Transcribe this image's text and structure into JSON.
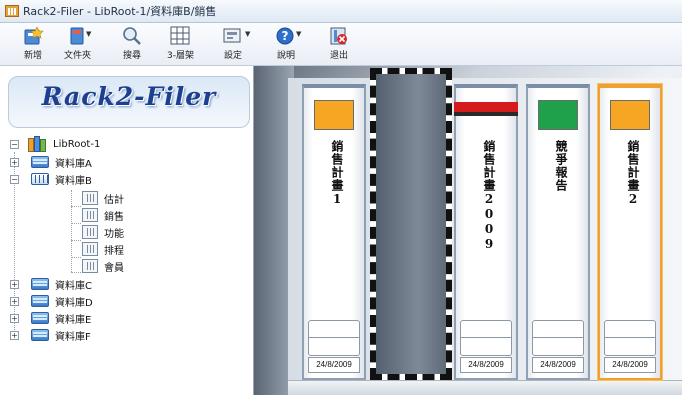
{
  "window": {
    "title": "Rack2-Filer - LibRoot-1/資料庫B/銷售"
  },
  "toolbar": {
    "buttons": [
      {
        "label": "新增",
        "icon": "new-binder-icon"
      },
      {
        "label": "文件夾",
        "icon": "binder-icon"
      },
      {
        "label": "搜尋",
        "icon": "search-icon"
      },
      {
        "label": "3-層架",
        "icon": "grid-icon"
      },
      {
        "label": "設定",
        "icon": "settings-icon"
      },
      {
        "label": "說明",
        "icon": "help-icon"
      },
      {
        "label": "退出",
        "icon": "exit-icon"
      }
    ]
  },
  "sidebar": {
    "logo_text": "Rack2-Filer",
    "tree": {
      "root": {
        "label": "LibRoot-1",
        "expanded": true
      },
      "libraries": [
        {
          "label": "資料庫A",
          "expanded": false
        },
        {
          "label": "資料庫B",
          "expanded": true,
          "children": [
            "估計",
            "銷售",
            "功能",
            "排程",
            "會員"
          ],
          "selected_child": "銷售"
        },
        {
          "label": "資料庫C",
          "expanded": false
        },
        {
          "label": "資料庫D",
          "expanded": false
        },
        {
          "label": "資料庫E",
          "expanded": false
        },
        {
          "label": "資料庫F",
          "expanded": false
        }
      ]
    }
  },
  "shelf": {
    "binders": [
      {
        "title": "銷售計畫1",
        "date": "24/8/2009",
        "color": "#f6a623",
        "style": "swatch",
        "selected": false
      },
      {
        "title": "",
        "date": "",
        "style": "empty",
        "selected": false
      },
      {
        "title": "銷售計畫2009",
        "date": "24/8/2009",
        "color": "#d41c1c",
        "style": "band",
        "selected": false
      },
      {
        "title": "競爭報告",
        "date": "24/8/2009",
        "color": "#1fa04a",
        "style": "swatch",
        "selected": false
      },
      {
        "title": "銷售計畫2",
        "date": "24/8/2009",
        "color": "#f6a623",
        "style": "swatch",
        "selected": true
      }
    ]
  }
}
